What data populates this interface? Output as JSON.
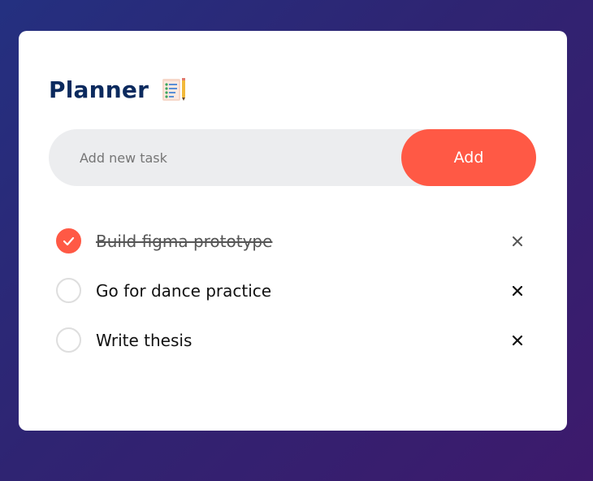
{
  "app": {
    "title": "Planner",
    "title_icon": "notepad-checklist-icon"
  },
  "input": {
    "placeholder": "Add new task",
    "value": "",
    "add_label": "Add"
  },
  "colors": {
    "accent": "#ff5945",
    "title": "#0b2a5e",
    "input_bg": "#ecedef",
    "background_gradient": [
      "#243080",
      "#3d1a6c"
    ]
  },
  "tasks": [
    {
      "text": "Build figma prototype",
      "completed": true
    },
    {
      "text": "Go for dance practice",
      "completed": false
    },
    {
      "text": "Write thesis",
      "completed": false
    }
  ]
}
